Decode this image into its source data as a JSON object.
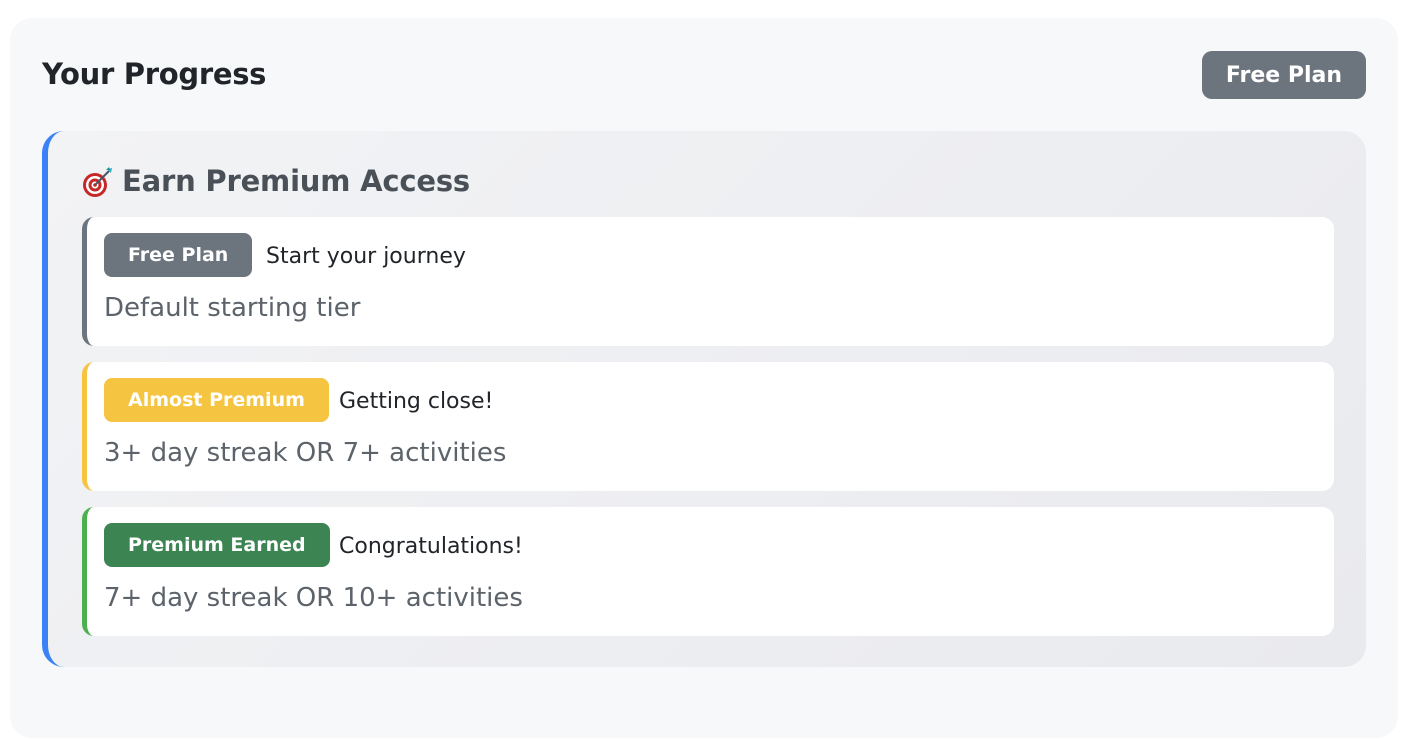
{
  "header": {
    "title": "Your Progress",
    "plan_badge": "Free Plan"
  },
  "premium_panel": {
    "title": "Earn Premium Access",
    "icon": "target-dart-icon",
    "accent_color": "#3b82f6",
    "tiers": [
      {
        "badge": "Free Plan",
        "subtitle": "Start your journey",
        "description": "Default starting tier",
        "color": "#6c757d"
      },
      {
        "badge": "Almost Premium",
        "subtitle": "Getting close!",
        "description": "3+ day streak OR 7+ activities",
        "color": "#f5c542"
      },
      {
        "badge": "Premium Earned",
        "subtitle": "Congratulations!",
        "description": "7+ day streak OR 10+ activities",
        "color": "#3c8553"
      }
    ]
  }
}
